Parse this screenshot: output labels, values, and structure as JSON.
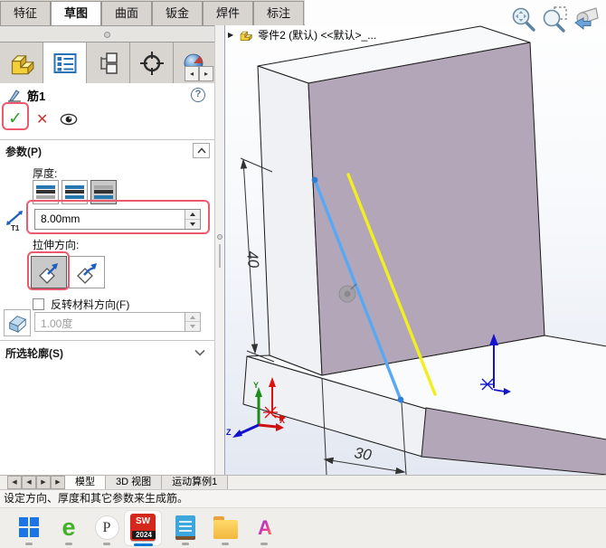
{
  "colors": {
    "highlight_red": "#ee5a6d",
    "face_purple": "#b3a6b8",
    "selected_line_blue": "#58a8f5",
    "preview_line_yellow": "#f2ef1f",
    "accent_blue": "#1e78c8",
    "taskbar_active_blue": "#0078d4"
  },
  "ribbon": {
    "tabs": [
      {
        "label": "特征",
        "active": false
      },
      {
        "label": "草图",
        "active": true
      },
      {
        "label": "曲面",
        "active": false
      },
      {
        "label": "钣金",
        "active": false
      },
      {
        "label": "焊件",
        "active": false
      },
      {
        "label": "标注",
        "active": false
      }
    ]
  },
  "panel_tabs": {
    "nav_left": "◂",
    "nav_right": "▸"
  },
  "property_manager": {
    "title": "筋1",
    "help_glyph": "?",
    "ok_glyph": "✓",
    "cancel_glyph": "✕",
    "parameters_header": "参数(P)",
    "thickness_label": "厚度:",
    "thickness_value": "8.00mm",
    "t1_label": "T1",
    "direction_label": "拉伸方向:",
    "flip_material_label": "反转材料方向(F)",
    "draft_value": "1.00度",
    "contours_header": "所选轮廓(S)"
  },
  "viewport": {
    "expander_glyph": "▶",
    "tree_item": "零件2 (默认) <<默认>_...",
    "dim_height": "40",
    "dim_width": "30",
    "axis_x": "X",
    "axis_y": "Y",
    "axis_z": "Z"
  },
  "doc_tabs": {
    "nav_glyphs": [
      "◀",
      "◀",
      "▶",
      "▶"
    ],
    "tabs": [
      {
        "label": "模型",
        "active": true
      },
      {
        "label": "3D 视图",
        "active": false
      },
      {
        "label": "运动算例1",
        "active": false
      }
    ]
  },
  "status_bar": {
    "message": "设定方向、厚度和其它参数来生成筋。"
  },
  "taskbar": {
    "apps": [
      {
        "name": "windows-start"
      },
      {
        "name": "browser-e",
        "glyph": "e"
      },
      {
        "name": "p-app",
        "glyph": "P"
      },
      {
        "name": "solidworks-2024",
        "glyph": "SW",
        "year": "2024",
        "active": true
      },
      {
        "name": "notepad"
      },
      {
        "name": "file-explorer"
      },
      {
        "name": "ai-app",
        "glyph": "A"
      }
    ]
  }
}
